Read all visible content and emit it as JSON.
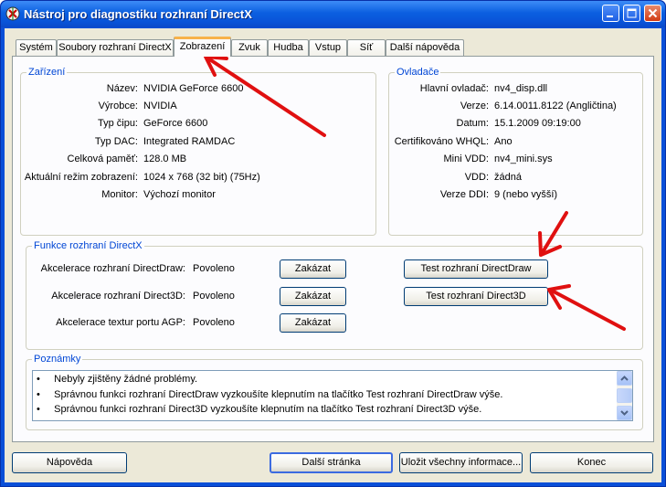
{
  "window": {
    "title": "Nástroj pro diagnostiku rozhraní DirectX"
  },
  "tabs": [
    {
      "label": "Systém"
    },
    {
      "label": "Soubory rozhraní DirectX"
    },
    {
      "label": "Zobrazení"
    },
    {
      "label": "Zvuk"
    },
    {
      "label": "Hudba"
    },
    {
      "label": "Vstup"
    },
    {
      "label": "Síť"
    },
    {
      "label": "Další nápověda"
    }
  ],
  "active_tab": "Zobrazení",
  "device": {
    "title": "Zařízení",
    "rows": [
      {
        "label": "Název:",
        "value": "NVIDIA GeForce 6600"
      },
      {
        "label": "Výrobce:",
        "value": "NVIDIA"
      },
      {
        "label": "Typ čipu:",
        "value": "GeForce 6600"
      },
      {
        "label": "Typ DAC:",
        "value": "Integrated RAMDAC"
      },
      {
        "label": "Celková paměť:",
        "value": "128.0 MB"
      },
      {
        "label": "Aktuální režim zobrazení:",
        "value": "1024 x 768 (32 bit) (75Hz)"
      },
      {
        "label": "Monitor:",
        "value": "Výchozí monitor"
      }
    ]
  },
  "drivers": {
    "title": "Ovladače",
    "rows": [
      {
        "label": "Hlavní ovladač:",
        "value": "nv4_disp.dll"
      },
      {
        "label": "Verze:",
        "value": "6.14.0011.8122 (Angličtina)"
      },
      {
        "label": "Datum:",
        "value": "15.1.2009 09:19:00"
      },
      {
        "label": "Certifikováno WHQL:",
        "value": "Ano"
      },
      {
        "label": "Mini VDD:",
        "value": "nv4_mini.sys"
      },
      {
        "label": "VDD:",
        "value": "žádná"
      },
      {
        "label": "Verze DDI:",
        "value": "9 (nebo vyšší)"
      }
    ]
  },
  "features": {
    "title": "Funkce rozhraní DirectX",
    "rows": [
      {
        "label": "Akcelerace rozhraní DirectDraw:",
        "value": "Povoleno",
        "button": "Zakázat",
        "test": "Test rozhraní DirectDraw"
      },
      {
        "label": "Akcelerace rozhraní Direct3D:",
        "value": "Povoleno",
        "button": "Zakázat",
        "test": "Test rozhraní Direct3D"
      },
      {
        "label": "Akcelerace textur portu AGP:",
        "value": "Povoleno",
        "button": "Zakázat"
      }
    ]
  },
  "notes": {
    "title": "Poznámky",
    "items": [
      "Nebyly zjištěny žádné problémy.",
      "Správnou funkci rozhraní DirectDraw vyzkoušíte klepnutím na tlačítko Test rozhraní DirectDraw výše.",
      "Správnou funkci rozhraní Direct3D vyzkoušíte klepnutím na tlačítko Test rozhraní Direct3D výše."
    ]
  },
  "footer": {
    "help": "Nápověda",
    "next": "Další stránka",
    "save": "Uložit všechny informace...",
    "exit": "Konec"
  },
  "colors": {
    "accent": "#0046d5",
    "annotation": "#e01010",
    "titlebar": "#0a5ae0"
  }
}
